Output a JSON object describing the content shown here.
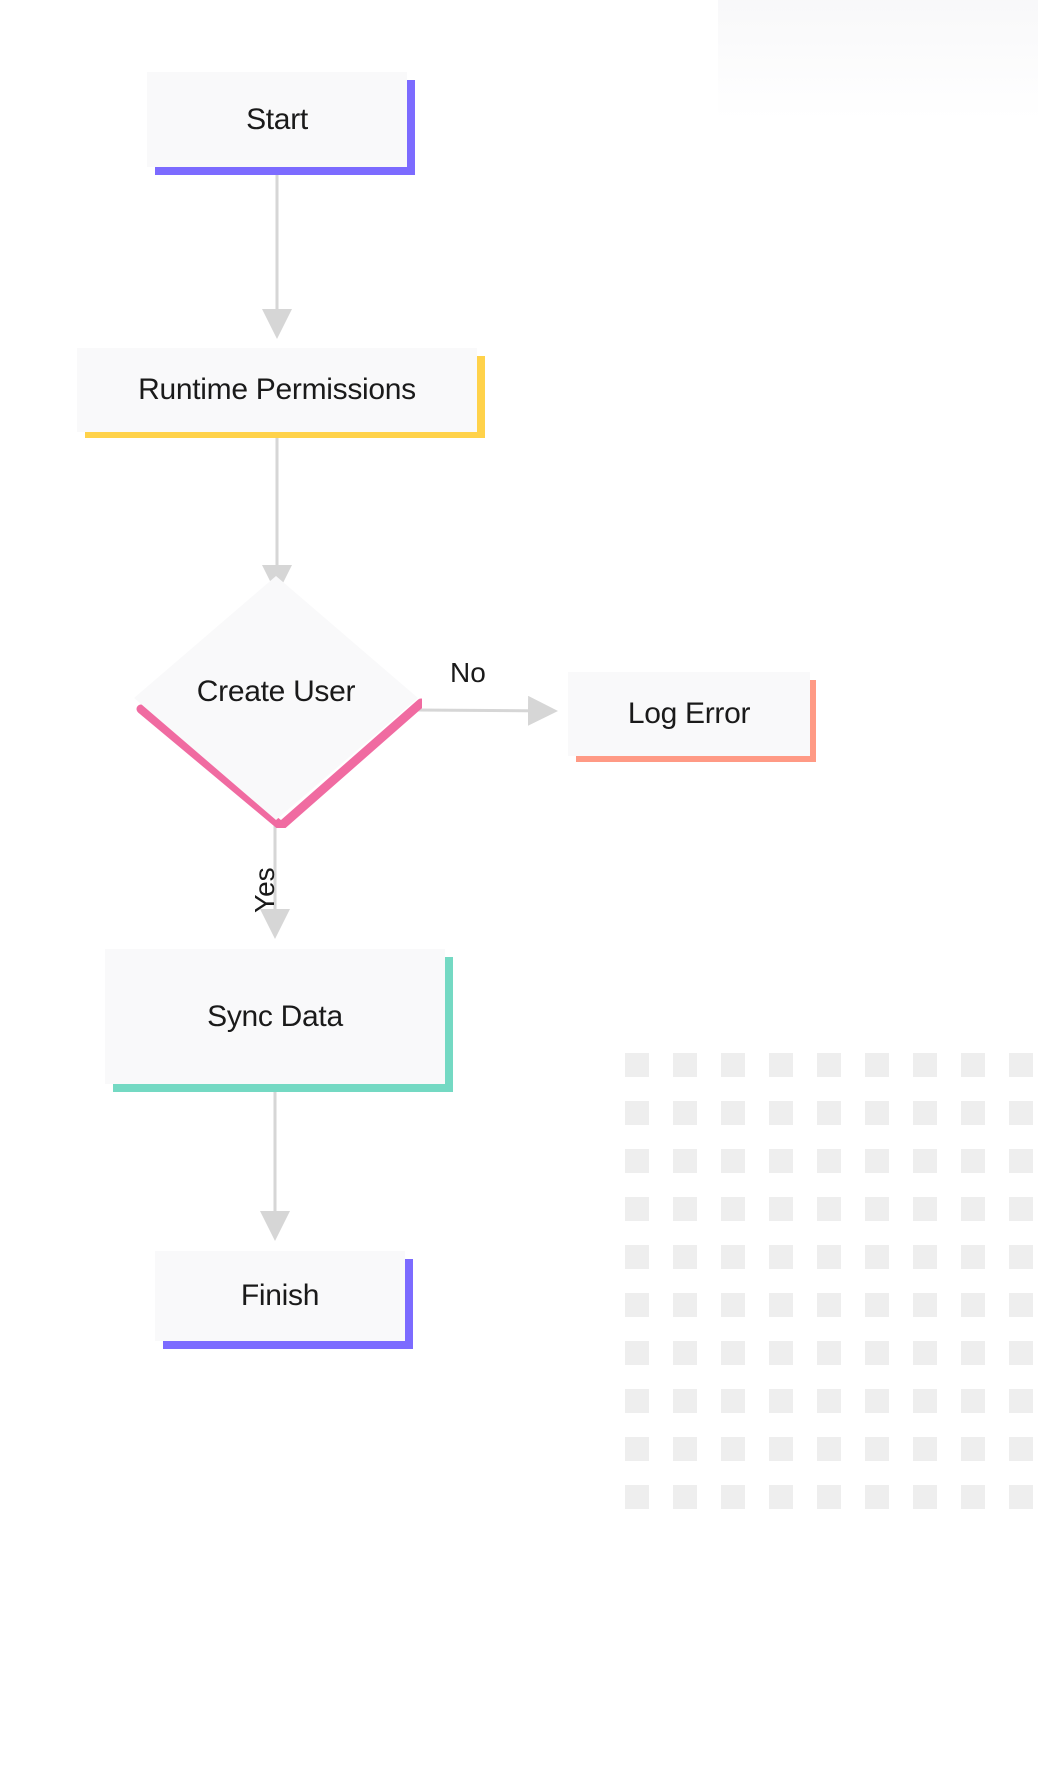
{
  "flow": {
    "start": {
      "label": "Start",
      "color_accent": "#7c6bff"
    },
    "runtime_permissions": {
      "label": "Runtime Permissions",
      "color_accent": "#ffd24a"
    },
    "create_user": {
      "label": "Create User",
      "color_accent": "#f06ba1"
    },
    "log_error": {
      "label": "Log Error",
      "color_accent": "#ff9a85"
    },
    "sync_data": {
      "label": "Sync Data",
      "color_accent": "#74d9c3"
    },
    "finish": {
      "label": "Finish",
      "color_accent": "#7c6bff"
    }
  },
  "edges": {
    "create_user_to_log_error": {
      "label": "No"
    },
    "create_user_to_sync_data": {
      "label": "Yes"
    }
  }
}
